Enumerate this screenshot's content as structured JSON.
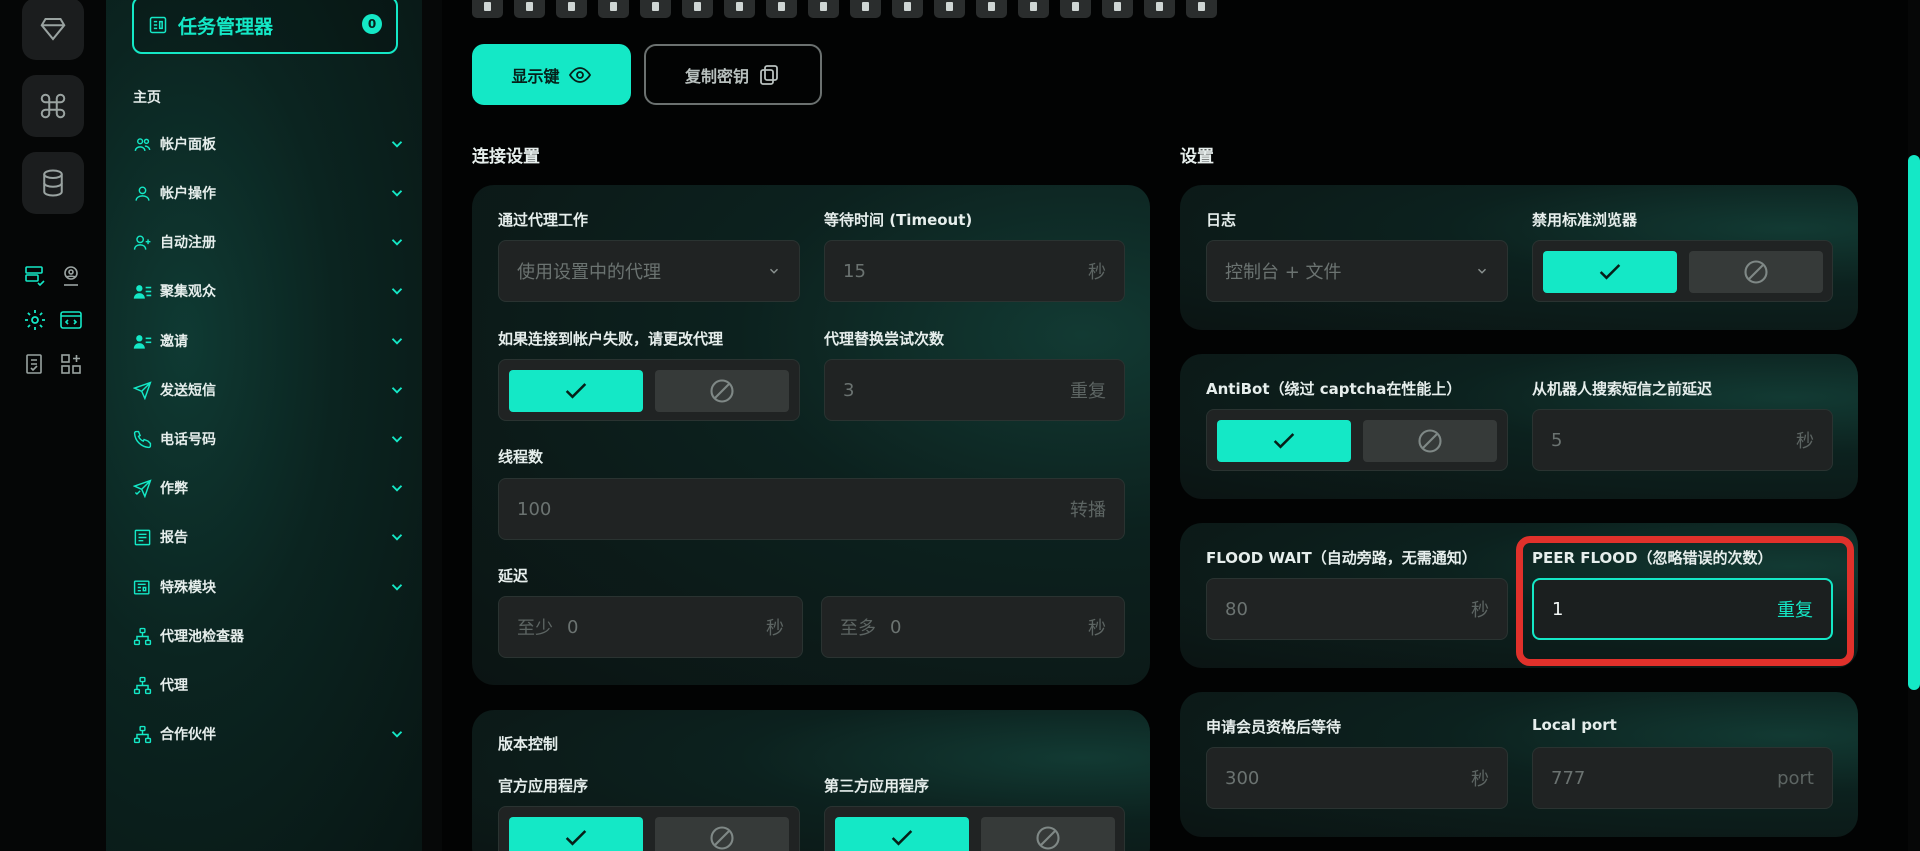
{
  "sidebar": {
    "task_manager": {
      "label": "任务管理器",
      "badge": "0"
    },
    "home": "主页",
    "items": [
      {
        "label": "帐户面板",
        "icon": "users-icon",
        "has_children": true
      },
      {
        "label": "帐户操作",
        "icon": "user-icon",
        "has_children": true
      },
      {
        "label": "自动注册",
        "icon": "user-plus-icon",
        "has_children": true
      },
      {
        "label": "聚集观众",
        "icon": "users-list-icon",
        "has_children": true
      },
      {
        "label": "邀请",
        "icon": "user-invite-icon",
        "has_children": true
      },
      {
        "label": "发送短信",
        "icon": "send-icon",
        "has_children": true
      },
      {
        "label": "电话号码",
        "icon": "phone-icon",
        "has_children": true
      },
      {
        "label": "作弊",
        "icon": "send-check-icon",
        "has_children": true
      },
      {
        "label": "报告",
        "icon": "report-icon",
        "has_children": true
      },
      {
        "label": "特殊模块",
        "icon": "newspaper-icon",
        "has_children": true
      },
      {
        "label": "代理池检查器",
        "icon": "network-icon",
        "has_children": false
      },
      {
        "label": "代理",
        "icon": "network-icon",
        "has_children": false
      },
      {
        "label": "合作伙伴",
        "icon": "network-icon",
        "has_children": true
      }
    ]
  },
  "top": {
    "show_key_label": "显示键",
    "copy_key_label": "复制密钥"
  },
  "connection": {
    "title": "连接设置",
    "proxy_work_label": "通过代理工作",
    "proxy_work_value": "使用设置中的代理",
    "timeout_label": "等待时间 (Timeout)",
    "timeout_value": "15",
    "timeout_unit": "秒",
    "change_proxy_label": "如果连接到帐户失败，请更改代理",
    "change_proxy_enabled": true,
    "proxy_attempts_label": "代理替换尝试次数",
    "proxy_attempts_value": "3",
    "proxy_attempts_unit": "重复",
    "threads_label": "线程数",
    "threads_value": "100",
    "threads_unit": "转播",
    "delay_label": "延迟",
    "delay_min_prefix": "至少",
    "delay_min_value": "0",
    "delay_min_unit": "秒",
    "delay_max_prefix": "至多",
    "delay_max_value": "0",
    "delay_max_unit": "秒"
  },
  "version": {
    "title": "版本控制",
    "official_label": "官方应用程序",
    "third_party_label": "第三方应用程序"
  },
  "settings": {
    "title": "设置",
    "log_label": "日志",
    "log_value": "控制台 + 文件",
    "disable_browser_label": "禁用标准浏览器",
    "disable_browser_enabled": true,
    "antibot_label": "AntiBot（绕过 captcha在性能上）",
    "antibot_enabled": true,
    "bot_delay_label": "从机器人搜索短信之前延迟",
    "bot_delay_value": "5",
    "bot_delay_unit": "秒",
    "flood_wait_label": "FLOOD WAIT（自动旁路，无需通知）",
    "flood_wait_value": "80",
    "flood_wait_unit": "秒",
    "peer_flood_label": "PEER FLOOD（忽略错误的次数）",
    "peer_flood_value": "1",
    "peer_flood_unit": "重复",
    "membership_wait_label": "申请会员资格后等待",
    "membership_wait_value": "300",
    "membership_wait_unit": "秒",
    "local_port_label": "Local port",
    "local_port_value": "777",
    "local_port_unit": "port"
  },
  "colors": {
    "accent": "#14e8c6",
    "highlight": "#e0312b"
  }
}
